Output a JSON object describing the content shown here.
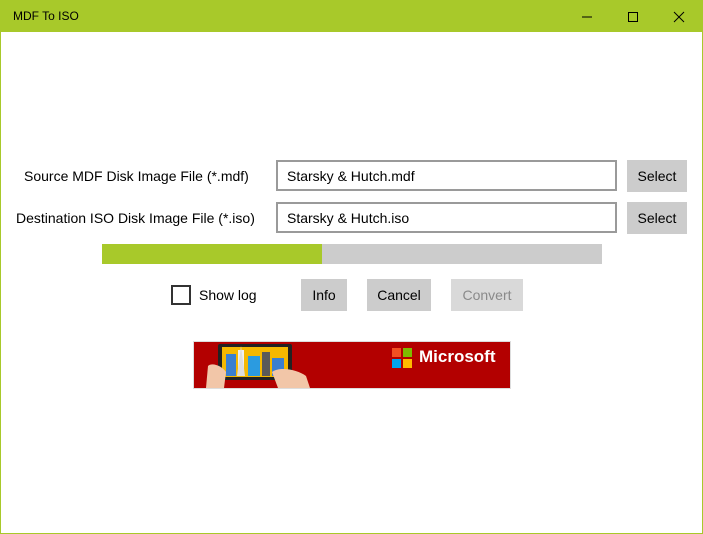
{
  "window": {
    "title": "MDF To ISO",
    "accent": "#a8c92a"
  },
  "source": {
    "label": "Source MDF Disk Image File (*.mdf)",
    "value": "Starsky & Hutch.mdf",
    "select_label": "Select"
  },
  "destination": {
    "label": "Destination ISO Disk Image File (*.iso)",
    "value": "Starsky & Hutch.iso",
    "select_label": "Select"
  },
  "progress": {
    "fraction": 0.44
  },
  "options": {
    "show_log_label": "Show log",
    "show_log_checked": false
  },
  "actions": {
    "info_label": "Info",
    "cancel_label": "Cancel",
    "convert_label": "Convert"
  },
  "ad": {
    "brand": "Microsoft",
    "background": "#b30000"
  }
}
